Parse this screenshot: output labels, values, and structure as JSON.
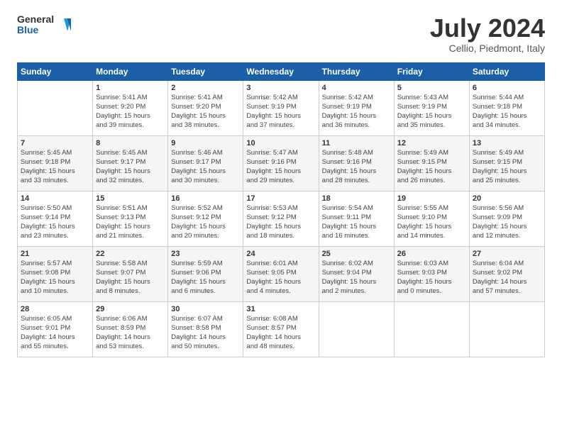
{
  "header": {
    "logo_line1": "General",
    "logo_line2": "Blue",
    "month": "July 2024",
    "location": "Cellio, Piedmont, Italy"
  },
  "days_of_week": [
    "Sunday",
    "Monday",
    "Tuesday",
    "Wednesday",
    "Thursday",
    "Friday",
    "Saturday"
  ],
  "weeks": [
    [
      {
        "day": "",
        "info": ""
      },
      {
        "day": "1",
        "info": "Sunrise: 5:41 AM\nSunset: 9:20 PM\nDaylight: 15 hours\nand 39 minutes."
      },
      {
        "day": "2",
        "info": "Sunrise: 5:41 AM\nSunset: 9:20 PM\nDaylight: 15 hours\nand 38 minutes."
      },
      {
        "day": "3",
        "info": "Sunrise: 5:42 AM\nSunset: 9:19 PM\nDaylight: 15 hours\nand 37 minutes."
      },
      {
        "day": "4",
        "info": "Sunrise: 5:42 AM\nSunset: 9:19 PM\nDaylight: 15 hours\nand 36 minutes."
      },
      {
        "day": "5",
        "info": "Sunrise: 5:43 AM\nSunset: 9:19 PM\nDaylight: 15 hours\nand 35 minutes."
      },
      {
        "day": "6",
        "info": "Sunrise: 5:44 AM\nSunset: 9:18 PM\nDaylight: 15 hours\nand 34 minutes."
      }
    ],
    [
      {
        "day": "7",
        "info": "Sunrise: 5:45 AM\nSunset: 9:18 PM\nDaylight: 15 hours\nand 33 minutes."
      },
      {
        "day": "8",
        "info": "Sunrise: 5:45 AM\nSunset: 9:17 PM\nDaylight: 15 hours\nand 32 minutes."
      },
      {
        "day": "9",
        "info": "Sunrise: 5:46 AM\nSunset: 9:17 PM\nDaylight: 15 hours\nand 30 minutes."
      },
      {
        "day": "10",
        "info": "Sunrise: 5:47 AM\nSunset: 9:16 PM\nDaylight: 15 hours\nand 29 minutes."
      },
      {
        "day": "11",
        "info": "Sunrise: 5:48 AM\nSunset: 9:16 PM\nDaylight: 15 hours\nand 28 minutes."
      },
      {
        "day": "12",
        "info": "Sunrise: 5:49 AM\nSunset: 9:15 PM\nDaylight: 15 hours\nand 26 minutes."
      },
      {
        "day": "13",
        "info": "Sunrise: 5:49 AM\nSunset: 9:15 PM\nDaylight: 15 hours\nand 25 minutes."
      }
    ],
    [
      {
        "day": "14",
        "info": "Sunrise: 5:50 AM\nSunset: 9:14 PM\nDaylight: 15 hours\nand 23 minutes."
      },
      {
        "day": "15",
        "info": "Sunrise: 5:51 AM\nSunset: 9:13 PM\nDaylight: 15 hours\nand 21 minutes."
      },
      {
        "day": "16",
        "info": "Sunrise: 5:52 AM\nSunset: 9:12 PM\nDaylight: 15 hours\nand 20 minutes."
      },
      {
        "day": "17",
        "info": "Sunrise: 5:53 AM\nSunset: 9:12 PM\nDaylight: 15 hours\nand 18 minutes."
      },
      {
        "day": "18",
        "info": "Sunrise: 5:54 AM\nSunset: 9:11 PM\nDaylight: 15 hours\nand 16 minutes."
      },
      {
        "day": "19",
        "info": "Sunrise: 5:55 AM\nSunset: 9:10 PM\nDaylight: 15 hours\nand 14 minutes."
      },
      {
        "day": "20",
        "info": "Sunrise: 5:56 AM\nSunset: 9:09 PM\nDaylight: 15 hours\nand 12 minutes."
      }
    ],
    [
      {
        "day": "21",
        "info": "Sunrise: 5:57 AM\nSunset: 9:08 PM\nDaylight: 15 hours\nand 10 minutes."
      },
      {
        "day": "22",
        "info": "Sunrise: 5:58 AM\nSunset: 9:07 PM\nDaylight: 15 hours\nand 8 minutes."
      },
      {
        "day": "23",
        "info": "Sunrise: 5:59 AM\nSunset: 9:06 PM\nDaylight: 15 hours\nand 6 minutes."
      },
      {
        "day": "24",
        "info": "Sunrise: 6:01 AM\nSunset: 9:05 PM\nDaylight: 15 hours\nand 4 minutes."
      },
      {
        "day": "25",
        "info": "Sunrise: 6:02 AM\nSunset: 9:04 PM\nDaylight: 15 hours\nand 2 minutes."
      },
      {
        "day": "26",
        "info": "Sunrise: 6:03 AM\nSunset: 9:03 PM\nDaylight: 15 hours\nand 0 minutes."
      },
      {
        "day": "27",
        "info": "Sunrise: 6:04 AM\nSunset: 9:02 PM\nDaylight: 14 hours\nand 57 minutes."
      }
    ],
    [
      {
        "day": "28",
        "info": "Sunrise: 6:05 AM\nSunset: 9:01 PM\nDaylight: 14 hours\nand 55 minutes."
      },
      {
        "day": "29",
        "info": "Sunrise: 6:06 AM\nSunset: 8:59 PM\nDaylight: 14 hours\nand 53 minutes."
      },
      {
        "day": "30",
        "info": "Sunrise: 6:07 AM\nSunset: 8:58 PM\nDaylight: 14 hours\nand 50 minutes."
      },
      {
        "day": "31",
        "info": "Sunrise: 6:08 AM\nSunset: 8:57 PM\nDaylight: 14 hours\nand 48 minutes."
      },
      {
        "day": "",
        "info": ""
      },
      {
        "day": "",
        "info": ""
      },
      {
        "day": "",
        "info": ""
      }
    ]
  ]
}
